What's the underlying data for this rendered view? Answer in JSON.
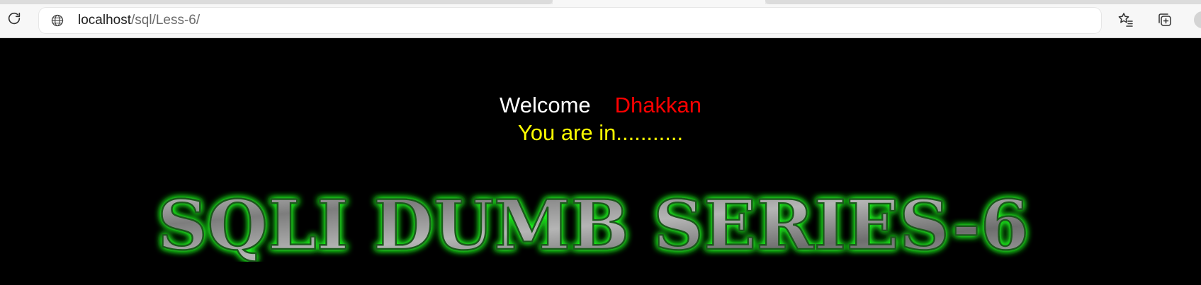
{
  "browser": {
    "url_host": "localhost",
    "url_path": "/sql/Less-6/",
    "icons": {
      "reload": "reload-icon",
      "site_info": "globe-icon",
      "favorite": "star-list-icon",
      "collections": "collections-icon",
      "profile": "avatar"
    }
  },
  "page": {
    "welcome_label": "Welcome",
    "user_name": "Dhakkan",
    "status_message": "You are in...........",
    "banner_title": "SQLI DUMB SERIES-6",
    "colors": {
      "background": "#000000",
      "welcome": "#ffffff",
      "user_name": "#ff0000",
      "status": "#ffff00",
      "banner_glow": "#22ff22"
    }
  }
}
